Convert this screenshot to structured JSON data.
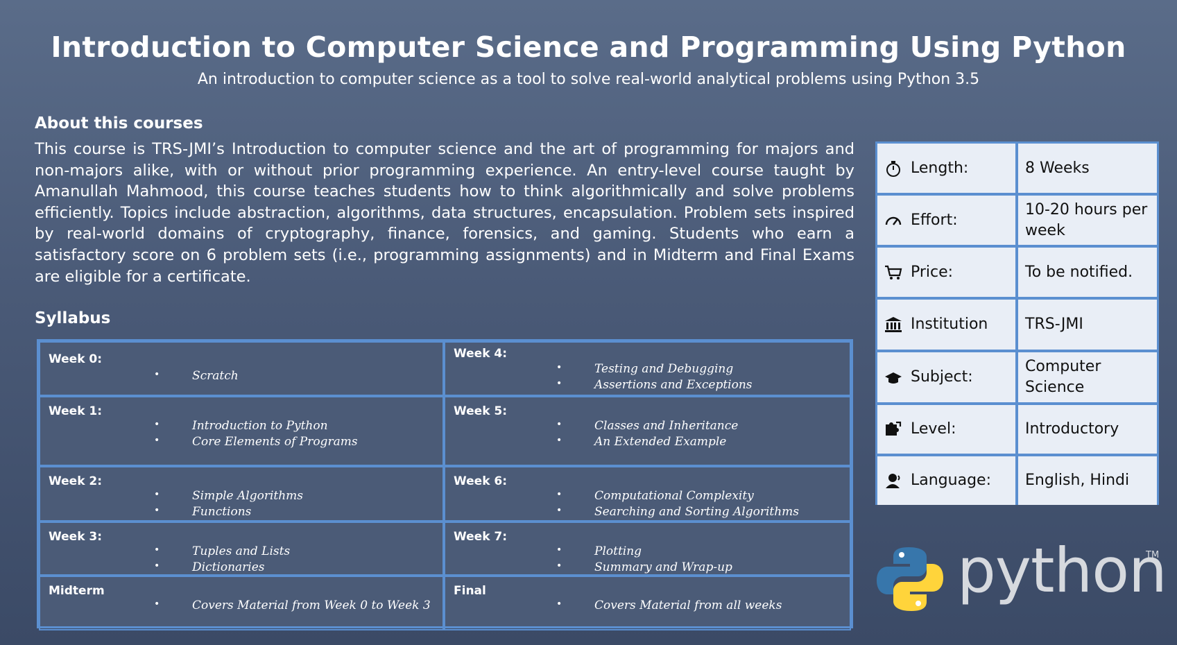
{
  "header": {
    "title": "Introduction to Computer Science and Programming Using Python",
    "subtitle": "An introduction to computer science as a tool to solve real-world analytical problems using Python 3.5"
  },
  "about": {
    "heading": "About this courses",
    "text": "This course is TRS-JMI’s Introduction to computer science and the art of programming for majors and non-majors alike, with or without prior programming experience. An entry-level course taught by Amanullah Mahmood, this course teaches students how to think algorithmically and solve problems efficiently. Topics include abstraction, algorithms, data structures, encapsulation. Problem sets inspired by real-world domains of cryptography, finance, forensics, and gaming. Students who earn a satisfactory score on 6 problem sets (i.e., programming assignments) and in Midterm and Final Exams are eligible for a certificate."
  },
  "syllabus": {
    "heading": "Syllabus",
    "cells": [
      {
        "title": "Week 0:",
        "topics": [
          "Scratch"
        ]
      },
      {
        "title": "Week 4:",
        "topics": [
          "Testing and Debugging",
          "Assertions and Exceptions"
        ]
      },
      {
        "title": "Week 1:",
        "topics": [
          "Introduction to Python",
          "Core Elements of Programs"
        ]
      },
      {
        "title": "Week 5:",
        "topics": [
          "Classes and Inheritance",
          "An Extended Example"
        ]
      },
      {
        "title": "Week 2:",
        "topics": [
          "Simple Algorithms",
          "Functions"
        ]
      },
      {
        "title": "Week 6:",
        "topics": [
          "Computational Complexity",
          "Searching and Sorting Algorithms"
        ]
      },
      {
        "title": "Week 3:",
        "topics": [
          "Tuples and Lists",
          "Dictionaries"
        ]
      },
      {
        "title": "Week 7:",
        "topics": [
          "Plotting",
          "Summary and Wrap-up"
        ]
      },
      {
        "title": "Midterm",
        "topics": [
          "Covers Material from Week 0 to Week 3"
        ]
      },
      {
        "title": "Final",
        "topics": [
          "Covers Material from all weeks"
        ]
      }
    ]
  },
  "info": {
    "rows": [
      {
        "icon": "stopwatch-icon",
        "label": "Length:",
        "value": "8 Weeks"
      },
      {
        "icon": "gauge-icon",
        "label": "Effort:",
        "value": "10-20 hours per week"
      },
      {
        "icon": "cart-icon",
        "label": "Price:",
        "value": "To be notified."
      },
      {
        "icon": "institution-icon",
        "label": "Institution",
        "value": "TRS-JMI"
      },
      {
        "icon": "graduation-cap-icon",
        "label": "Subject:",
        "value": "Computer Science"
      },
      {
        "icon": "puzzle-icon",
        "label": "Level:",
        "value": "Introductory"
      },
      {
        "icon": "speaker-person-icon",
        "label": "Language:",
        "value": "English, Hindi"
      }
    ]
  },
  "logo": {
    "word": "python",
    "tm": "TM",
    "colors": {
      "blue": "#3776ab",
      "yellow": "#ffd43b"
    }
  }
}
